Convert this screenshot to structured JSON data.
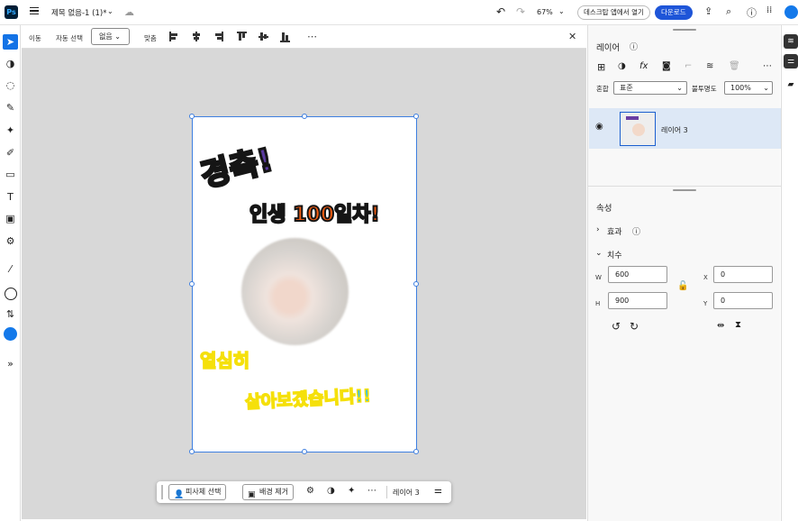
{
  "app": {
    "logo": "Ps",
    "doc_title": "제목 없음-1 (1)*"
  },
  "topbar": {
    "zoom": "67%",
    "open_desktop": "데스크탑 앱에서 열기",
    "download": "다운로드"
  },
  "options": {
    "move": "이동",
    "auto_select": "자동 선택",
    "auto_select_value": "없음",
    "align": "맞춤"
  },
  "canvas_text": {
    "line1": "경축!",
    "line2": "인생 100일차!",
    "line3": "열심히",
    "line4": "살아보겠습니다!!"
  },
  "context_bar": {
    "select_subject": "피사체 선택",
    "remove_bg": "배경 제거",
    "layer_name": "레이어 3"
  },
  "layers_panel": {
    "title": "레이어",
    "blend_label": "혼합",
    "blend_value": "표준",
    "opacity_label": "불투명도",
    "opacity_value": "100%",
    "layers": [
      {
        "name": "레이어 3"
      }
    ]
  },
  "properties": {
    "title": "속성",
    "effects": "효과",
    "dimensions": "치수",
    "w_label": "W",
    "w_value": "600",
    "h_label": "H",
    "h_value": "900",
    "x_label": "X",
    "x_value": "0",
    "y_label": "Y",
    "y_value": "0"
  },
  "colors": {
    "accent": "#1473e6",
    "download_btn": "#1e55d8",
    "layer_selected": "#dde8f6",
    "selection": "#3e7fe0"
  }
}
